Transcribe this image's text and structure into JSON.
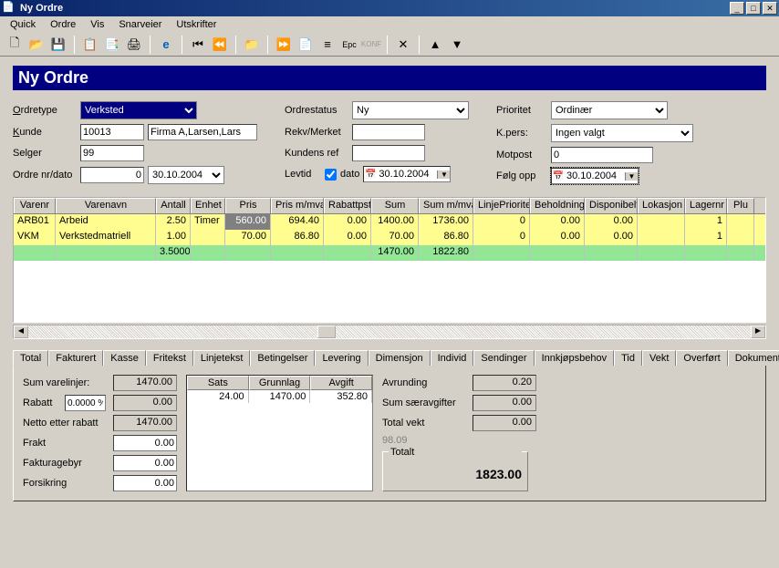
{
  "window_title": "Ny Ordre",
  "menu": [
    "Quick",
    "Ordre",
    "Vis",
    "Snarveier",
    "Utskrifter"
  ],
  "header": "Ny Ordre",
  "form": {
    "ordretype_lbl": "Ordretype",
    "ordretype": "Verksted",
    "kunde_lbl": "Kunde",
    "kunde_id": "10013",
    "kunde_name": "Firma A,Larsen,Lars",
    "selger_lbl": "Selger",
    "selger": "99",
    "ordrenr_lbl": "Ordre nr/dato",
    "ordrenr": "0",
    "ordredato": "30.10.2004",
    "ordrestatus_lbl": "Ordrestatus",
    "ordrestatus": "Ny",
    "rekv_lbl": "Rekv/Merket",
    "rekv": "",
    "kundref_lbl": "Kundens ref",
    "kundref": "",
    "levtid_lbl": "Levtid",
    "dato_lbl": "dato",
    "levdato": "30.10.2004",
    "prioritet_lbl": "Prioritet",
    "prioritet": "Ordinær",
    "kpers_lbl": "K.pers:",
    "kpers": "Ingen valgt",
    "motpost_lbl": "Motpost",
    "motpost": "0",
    "folgopp_lbl": "Følg opp",
    "folgoppdato": "30.10.2004"
  },
  "grid": {
    "cols": [
      "Varenr",
      "Varenavn",
      "Antall",
      "Enhet",
      "Pris",
      "Pris m/mva",
      "Rabattpst",
      "Sum",
      "Sum m/mva",
      "LinjePrioritet",
      "Beholdning",
      "Disponibelt",
      "Lokasjon",
      "Lagernr",
      "Plu"
    ],
    "rows": [
      {
        "varenr": "ARB01",
        "varenavn": "Arbeid",
        "antall": "2.50",
        "enhet": "Timer",
        "pris": "560.00",
        "prismva": "694.40",
        "rabatt": "0.00",
        "sum": "1400.00",
        "summva": "1736.00",
        "linjep": "0",
        "beholdning": "0.00",
        "disp": "0.00",
        "lokasjon": "",
        "lagernr": "1"
      },
      {
        "varenr": "VKM",
        "varenavn": "Verkstedmatriell",
        "antall": "1.00",
        "enhet": "",
        "pris": "70.00",
        "prismva": "86.80",
        "rabatt": "0.00",
        "sum": "70.00",
        "summva": "86.80",
        "linjep": "0",
        "beholdning": "0.00",
        "disp": "0.00",
        "lokasjon": "",
        "lagernr": "1"
      }
    ],
    "total_row": {
      "antall": "3.5000",
      "sum": "1470.00",
      "summva": "1822.80"
    }
  },
  "tabs": [
    "Total",
    "Fakturert",
    "Kasse",
    "Fritekst",
    "Linjetekst",
    "Betingelser",
    "Levering",
    "Dimensjon",
    "Individ",
    "Sendinger",
    "Innkjøpsbehov",
    "Tid",
    "Vekt",
    "Overført",
    "Dokumente"
  ],
  "totals": {
    "sum_vl_lbl": "Sum varelinjer:",
    "sum_vl": "1470.00",
    "rabatt_lbl": "Rabatt",
    "rabatt_pct": "0.0000 %",
    "rabatt": "0.00",
    "netto_lbl": "Netto etter rabatt",
    "netto": "1470.00",
    "frakt_lbl": "Frakt",
    "frakt": "0.00",
    "gebyr_lbl": "Fakturagebyr",
    "gebyr": "0.00",
    "forsikring_lbl": "Forsikring",
    "forsikring": "0.00"
  },
  "vat": {
    "cols": [
      "Sats",
      "Grunnlag",
      "Avgift"
    ],
    "row": [
      "24.00",
      "1470.00",
      "352.80"
    ]
  },
  "right": {
    "avrunding_lbl": "Avrunding",
    "avrunding": "0.20",
    "saer_lbl": "Sum særavgifter",
    "saer": "0.00",
    "vekt_lbl": "Total vekt",
    "vekt": "0.00",
    "faded": "98.09",
    "totalt_lbl": "Totalt",
    "totalt": "1823.00"
  }
}
